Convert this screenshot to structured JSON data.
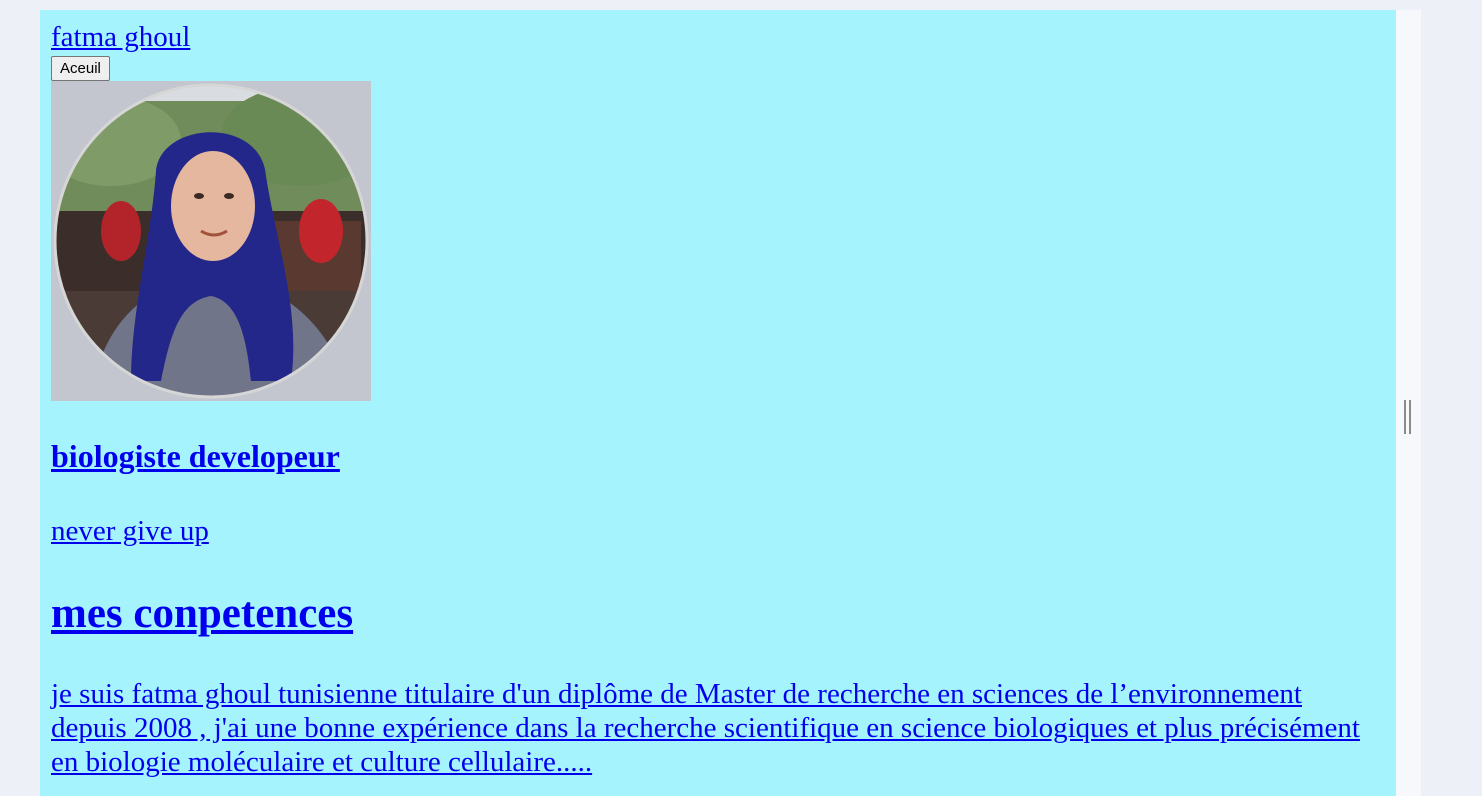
{
  "header": {
    "brand": "fatma ghoul",
    "home_button": "Aceuil"
  },
  "profile": {
    "role": "biologiste developeur",
    "motto": "never give up"
  },
  "skills": {
    "title": "mes conpetences",
    "bio": "je suis fatma ghoul tunisienne titulaire d'un diplôme de Master de recherche en sciences de l’environnement depuis 2008 , j'ai une bonne expérience dans la recherche scientifique en science biologiques et plus précisément en biologie moléculaire et culture cellulaire....."
  },
  "colors": {
    "page_background": "#a5f3fc",
    "link": "#0000ee"
  }
}
